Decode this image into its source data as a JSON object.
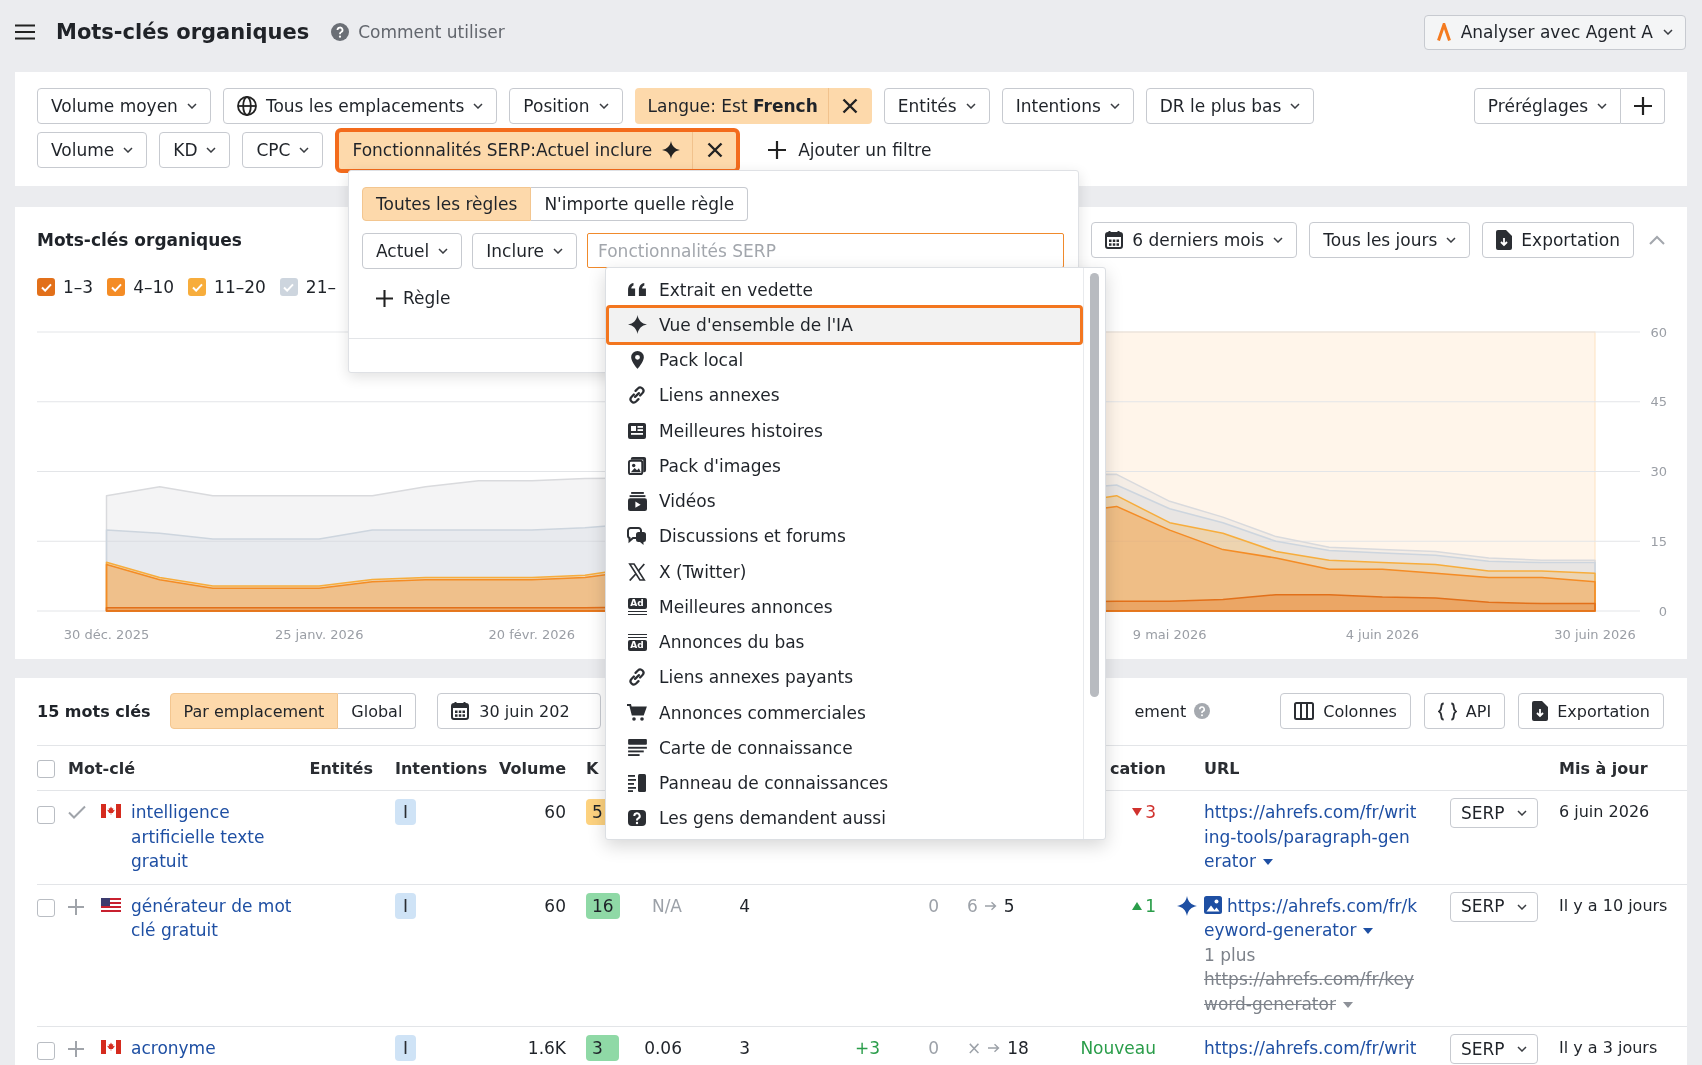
{
  "top_bar": {
    "title": "Mots-clés organiques",
    "help_link": "Comment utiliser",
    "agent_button": "Analyser avec Agent A"
  },
  "filters": {
    "rows": [
      {
        "items": [
          {
            "kind": "dropdown",
            "label": "Volume moyen"
          },
          {
            "kind": "location",
            "label": "Tous les emplacements"
          },
          {
            "kind": "dropdown",
            "label": "Position"
          },
          {
            "kind": "active",
            "label": "Langue: Est **French**",
            "ai": false,
            "highlighted": false
          },
          {
            "kind": "dropdown",
            "label": "Entités"
          },
          {
            "kind": "dropdown",
            "label": "Intentions"
          },
          {
            "kind": "dropdown",
            "label": "DR le plus bas"
          }
        ]
      },
      {
        "items": [
          {
            "kind": "dropdown",
            "label": "Volume"
          },
          {
            "kind": "dropdown",
            "label": "KD"
          },
          {
            "kind": "dropdown",
            "label": "CPC"
          },
          {
            "kind": "active",
            "label": "Fonctionnalités SERP:Actuel inclure",
            "ai": true,
            "highlighted": true
          },
          {
            "kind": "add",
            "label": "Ajouter un filtre"
          }
        ]
      }
    ],
    "presets": "Préréglages"
  },
  "filter_editor": {
    "match_modes": [
      {
        "label": "Toutes les règles",
        "selected": true
      },
      {
        "label": "N'importe quelle règle",
        "selected": false
      }
    ],
    "scope": "Actuel",
    "operator": "Inclure",
    "value_field": {
      "placeholder": "Fonctionnalités SERP",
      "focused": true
    },
    "add_rule": "Règle"
  },
  "feature_menu": {
    "options": [
      {
        "kind": "snippet",
        "label": "Extrait en vedette",
        "selected": false
      },
      {
        "kind": "ai",
        "label": "Vue d'ensemble de l'IA",
        "selected": true
      },
      {
        "kind": "local",
        "label": "Pack local",
        "selected": false
      },
      {
        "kind": "sitelinks",
        "label": "Liens annexes",
        "selected": false
      },
      {
        "kind": "stories",
        "label": "Meilleures histoires",
        "selected": false
      },
      {
        "kind": "images",
        "label": "Pack d'images",
        "selected": false
      },
      {
        "kind": "videos",
        "label": "Vidéos",
        "selected": false
      },
      {
        "kind": "discussions",
        "label": "Discussions et forums",
        "selected": false
      },
      {
        "kind": "x",
        "label": "X (Twitter)",
        "selected": false
      },
      {
        "kind": "top_ads",
        "label": "Meilleures annonces",
        "icon_text": "Ad",
        "selected": false
      },
      {
        "kind": "bottom_ads",
        "label": "Annonces du bas",
        "icon_text": "Ad",
        "selected": false
      },
      {
        "kind": "paid_sitelinks",
        "label": "Liens annexes payants",
        "selected": false
      },
      {
        "kind": "shopping",
        "label": "Annonces commerciales",
        "selected": false
      },
      {
        "kind": "knowledge_card",
        "label": "Carte de connaissance",
        "selected": false
      },
      {
        "kind": "knowledge_panel",
        "label": "Panneau de connaissances",
        "selected": false
      },
      {
        "kind": "questions",
        "label": "Les gens demandent aussi",
        "selected": false
      }
    ]
  },
  "chart_panel": {
    "title": "Mots-clés organiques",
    "period": "6 derniers mois",
    "interval": "Tous les jours",
    "export": "Exportation",
    "expanded": true,
    "shaded_range": true,
    "legend": [
      {
        "checked": true
      },
      {
        "checked": true
      },
      {
        "checked": true
      },
      {
        "checked": true
      }
    ],
    "chart_data": {
      "type": "area",
      "stacked": false,
      "grid": true,
      "categories": [
        "30 déc. 2025",
        null,
        null,
        null,
        "25 janv. 2026",
        null,
        null,
        null,
        "20 févr. 2026",
        null,
        null,
        null,
        null,
        null,
        null,
        null,
        null,
        null,
        null,
        null,
        "9 mai 2026",
        null,
        null,
        null,
        "4 juin 2026",
        null,
        null,
        null,
        "30 juin 2026"
      ],
      "ylim": [
        0,
        60
      ],
      "yticks": [
        0,
        15,
        30,
        45,
        60
      ],
      "series": [
        {
          "name": "1–3",
          "color": "#e2701a",
          "values": [
            0.7,
            0.7,
            0.7,
            0.7,
            0.7,
            0.7,
            0.7,
            0.7,
            0.7,
            0.7,
            null,
            null,
            null,
            null,
            null,
            null,
            null,
            null,
            null,
            2.1,
            2.1,
            2.5,
            3.5,
            3.5,
            3,
            2.8,
            1.9,
            1.6,
            1.6
          ]
        },
        {
          "name": "4–10",
          "color": "#f48c25",
          "values": [
            10,
            6.7,
            4.9,
            4.9,
            4.9,
            6.3,
            6.7,
            6.7,
            6.7,
            7.2,
            null,
            null,
            null,
            null,
            null,
            null,
            null,
            null,
            null,
            22.5,
            17.4,
            13.2,
            11.4,
            9,
            9,
            8.1,
            7.2,
            7.2,
            6.3
          ]
        },
        {
          "name": "11–20",
          "color": "#f7ad3c",
          "values": [
            10.5,
            7.2,
            5.4,
            5.4,
            5.4,
            6.8,
            7.2,
            7.2,
            7.2,
            7.7,
            null,
            null,
            null,
            null,
            null,
            null,
            null,
            null,
            null,
            24.8,
            19,
            16.7,
            12.8,
            10.9,
            10.4,
            10,
            8.6,
            8.6,
            8.1
          ]
        },
        {
          "name": "21–",
          "color": "#cdd5de",
          "values": [
            17.4,
            16.7,
            15.5,
            15.5,
            15.5,
            17.4,
            17.4,
            17.4,
            17.4,
            17.9,
            null,
            null,
            null,
            null,
            null,
            null,
            null,
            null,
            null,
            27.1,
            22,
            19,
            15,
            13,
            12.5,
            12,
            10.7,
            10.4,
            10.4
          ]
        },
        {
          "color": "#d9dadd",
          "values": [
            24.8,
            26.7,
            24.8,
            24.8,
            24.8,
            24.8,
            26.7,
            28,
            28,
            28.5,
            null,
            null,
            null,
            null,
            null,
            null,
            null,
            null,
            null,
            29.4,
            23.6,
            20.2,
            16,
            13.7,
            13.2,
            12.8,
            11.4,
            10.9,
            10.9
          ]
        }
      ]
    }
  },
  "table": {
    "count": "15 mots clés",
    "view_modes": [
      {
        "label": "Par emplacement",
        "selected": true
      },
      {
        "label": "Global",
        "selected": false
      }
    ],
    "date": "30 juin 202",
    "compare_label": "ement",
    "buttons": [
      {
        "kind": "columns",
        "label": "Colonnes"
      },
      {
        "kind": "api",
        "label": "API"
      },
      {
        "kind": "export",
        "label": "Exportation"
      }
    ],
    "select_all": {
      "checked": false
    },
    "headers": {
      "keyword": "Mot-clé",
      "entities": "Entités",
      "intents": "Intentions",
      "volume": "Volume",
      "column_5": "K",
      "column_11": "cation",
      "url": "URL",
      "updated": "Mis à jour"
    },
    "rows": [
      {
        "checked": false,
        "added": true,
        "flag": {
          "kind": "ca"
        },
        "keyword": "intelligence artificielle texte gratuit",
        "intent": "I",
        "volume": "60",
        "column_5": {
          "text": "5",
          "color": "#fdd27f"
        },
        "column_11": {
          "text": "3",
          "kind": "down"
        },
        "ai_overview": false,
        "url": "https://ahrefs.com/fr/writing-tools/paragraph-generator",
        "url_menu": true,
        "serp": "SERP",
        "updated": "6 juin 2026"
      },
      {
        "checked": false,
        "added": false,
        "flag": {
          "kind": "us"
        },
        "keyword": "générateur de mot clé gratuit",
        "intent": "I",
        "volume": "60",
        "column_5": {
          "text": "16",
          "color": "#8fd9a6"
        },
        "column_6": {
          "text": "N/A",
          "dimmed": true
        },
        "column_7": "4",
        "column_9": "0",
        "column_10": {
          "from": "6",
          "to": "5"
        },
        "column_11": {
          "text": "1",
          "kind": "up"
        },
        "ai_overview": true,
        "media": {
          "kind": "image"
        },
        "url": "https://ahrefs.com/fr/keyword-generator",
        "url_menu": true,
        "more_label": "1 plus",
        "old_url": "https://ahrefs.com/fr/keyword-generator",
        "old_url_menu": true,
        "serp": "SERP",
        "updated": "Il y a 10 jours"
      },
      {
        "checked": false,
        "added": false,
        "flag": {
          "kind": "ca"
        },
        "keyword": "acronyme",
        "intent": "I",
        "volume": "1.6K",
        "column_5": {
          "text": "3",
          "color": "#8fd9a6"
        },
        "column_6": {
          "text": "0.06",
          "dimmed": false
        },
        "column_7": "3",
        "column_8": {
          "text": "+3",
          "kind": "up"
        },
        "column_9": "0",
        "column_10": {
          "from": "×",
          "to": "18"
        },
        "column_11": {
          "text": "Nouveau",
          "kind": "new"
        },
        "ai_overview": false,
        "url": "https://ahrefs.com/fr/writ",
        "url_menu": false,
        "serp": "SERP",
        "updated": "Il y a 3 jours"
      }
    ]
  }
}
